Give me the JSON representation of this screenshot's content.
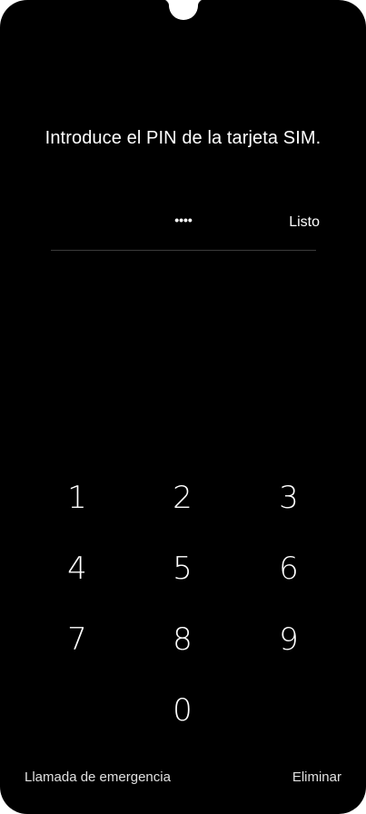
{
  "prompt": {
    "title": "Introduce el PIN de la tarjeta SIM."
  },
  "pin": {
    "masked_value": "••••",
    "done_label": "Listo"
  },
  "keypad": {
    "keys": [
      "1",
      "2",
      "3",
      "4",
      "5",
      "6",
      "7",
      "8",
      "9",
      "0"
    ]
  },
  "footer": {
    "emergency_label": "Llamada de emergencia",
    "delete_label": "Eliminar"
  }
}
